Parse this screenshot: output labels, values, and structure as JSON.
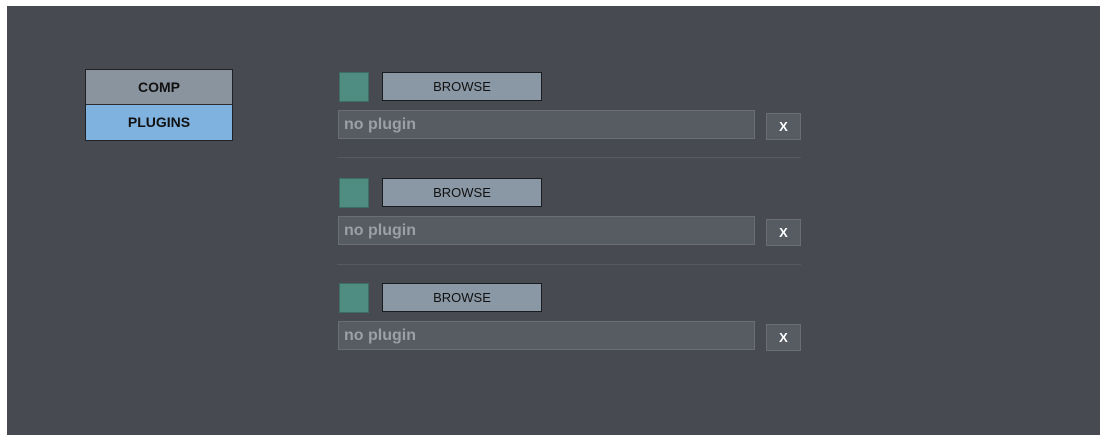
{
  "tabs": {
    "comp_label": "COMP",
    "plugins_label": "PLUGINS",
    "active": "PLUGINS"
  },
  "slots": [
    {
      "browse_label": "BROWSE",
      "plugin_value": "no plugin",
      "clear_label": "X"
    },
    {
      "browse_label": "BROWSE",
      "plugin_value": "no plugin",
      "clear_label": "X"
    },
    {
      "browse_label": "BROWSE",
      "plugin_value": "no plugin",
      "clear_label": "X"
    }
  ],
  "colors": {
    "background": "#474a51",
    "active_tab": "#80b2df",
    "inactive_tab": "#8a949e",
    "slot_swatch": "#4f8c82"
  }
}
